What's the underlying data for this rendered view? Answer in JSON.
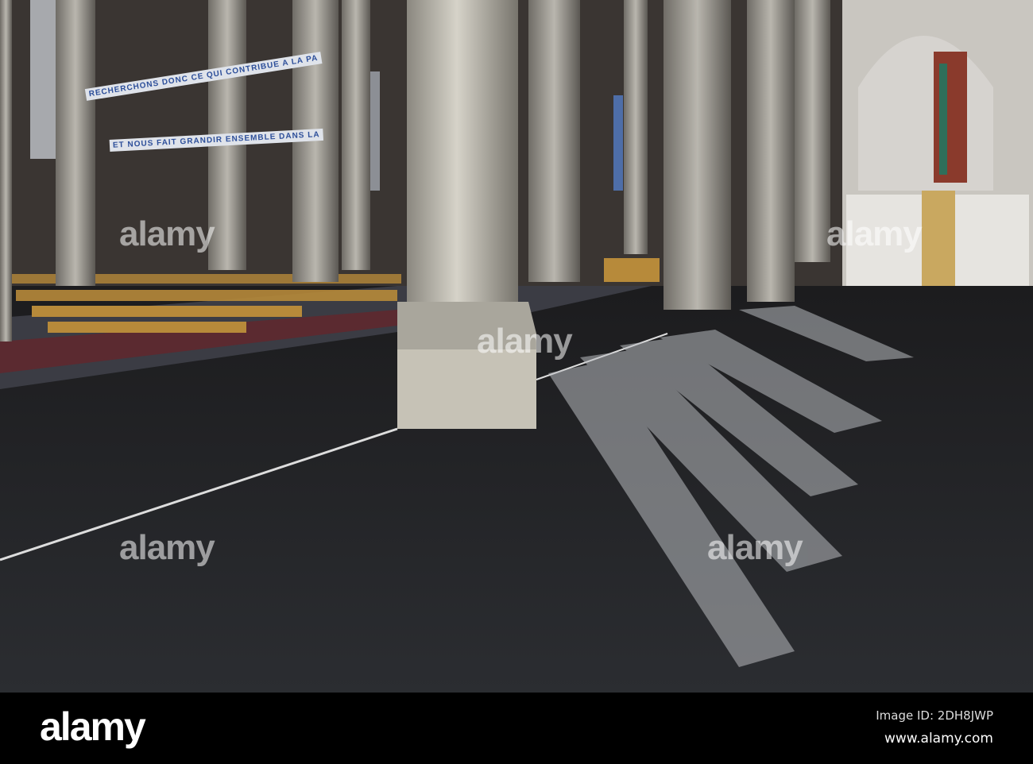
{
  "photo": {
    "banner_line1": "RECHERCHONS DONC CE QUI CONTRIBUE A LA PA",
    "banner_line2": "ET NOUS FAIT GRANDIR ENSEMBLE DANS LA",
    "watermark": "alamy"
  },
  "footer": {
    "logo": "alamy",
    "image_id": "Image ID: 2DH8JWP",
    "url": "www.alamy.com"
  }
}
